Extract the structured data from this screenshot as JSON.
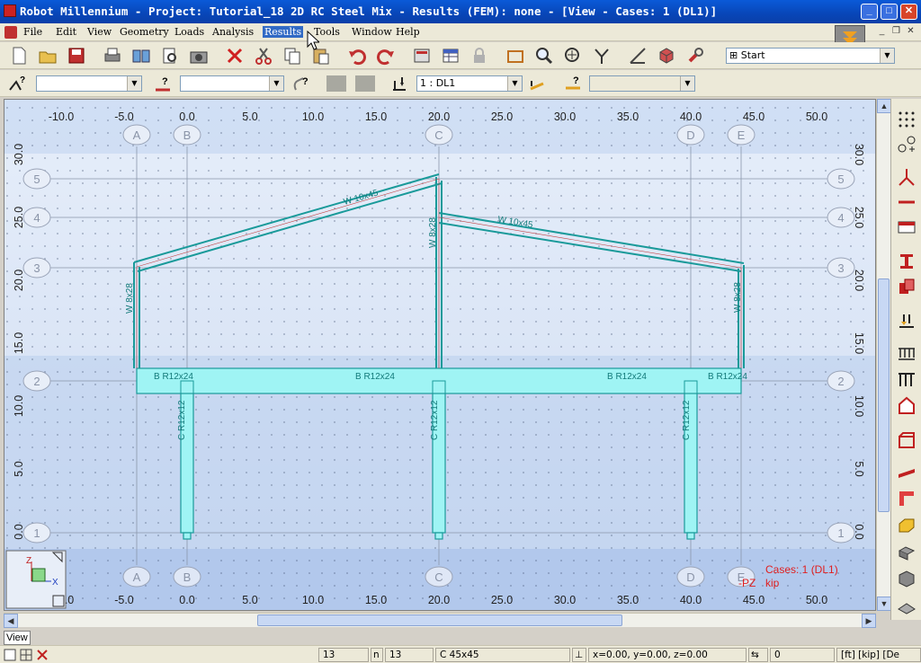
{
  "window": {
    "title": "Robot Millennium - Project: Tutorial_18 2D RC Steel Mix - Results (FEM): none - [View - Cases: 1 (DL1)]",
    "min_glyph": "_",
    "max_glyph": "□",
    "close_glyph": "✕"
  },
  "menu": {
    "items": [
      {
        "label": "File"
      },
      {
        "label": "Edit"
      },
      {
        "label": "View"
      },
      {
        "label": "Geometry"
      },
      {
        "label": "Loads"
      },
      {
        "label": "Analysis"
      },
      {
        "label": "Results"
      },
      {
        "label": "Tools"
      },
      {
        "label": "Window"
      },
      {
        "label": "Help"
      }
    ],
    "active": "Results"
  },
  "toolbar": {
    "layout_select": "Start",
    "case_select": "1 : DL1"
  },
  "view": {
    "x_ticks": [
      "-10.0",
      "-5.0",
      "0.0",
      "5.0",
      "10.0",
      "15.0",
      "20.0",
      "25.0",
      "30.0",
      "35.0",
      "40.0",
      "45.0",
      "50.0"
    ],
    "y_ticks": [
      "30.0",
      "25.0",
      "20.0",
      "15.0",
      "10.0",
      "5.0",
      "0.0"
    ],
    "grid_columns": [
      "A",
      "B",
      "C",
      "D",
      "E"
    ],
    "grid_levels": [
      "5",
      "4",
      "3",
      "2",
      "1"
    ],
    "member_labels": {
      "rafter_left": "W 10x45",
      "rafter_right": "W 10x45",
      "col_upper_left": "W 8x28",
      "col_upper_mid": "W 8x28",
      "col_upper_right": "W 8x28",
      "beam_1": "B R12x24",
      "beam_2": "B R12x24",
      "beam_3": "B R12x24",
      "beam_4": "B R12x24",
      "rc_col_1": "C R12x12",
      "rc_col_2": "C R12x12",
      "rc_col_3": "C R12x12"
    },
    "cases_label": "Cases: 1 (DL1)",
    "unit_label": "kip",
    "axis_label_pz": "-PZ",
    "axis_z": "Z",
    "axis_x": "X",
    "colors": {
      "background": "#dfe8f8",
      "band_dark": "#bcd0ef",
      "steel_member": "#1a9a9a",
      "concrete_fill": "#9ff4f4",
      "label_text": "#137a7a",
      "result_text": "#e02020"
    }
  },
  "bottom": {
    "view_tab": "View"
  },
  "status": {
    "field_1": "13",
    "field_2": "13",
    "section": "C 45x45",
    "coords": "x=0.00, y=0.00, z=0.00",
    "angle": "0",
    "units": "[ft] [kip] [De"
  }
}
